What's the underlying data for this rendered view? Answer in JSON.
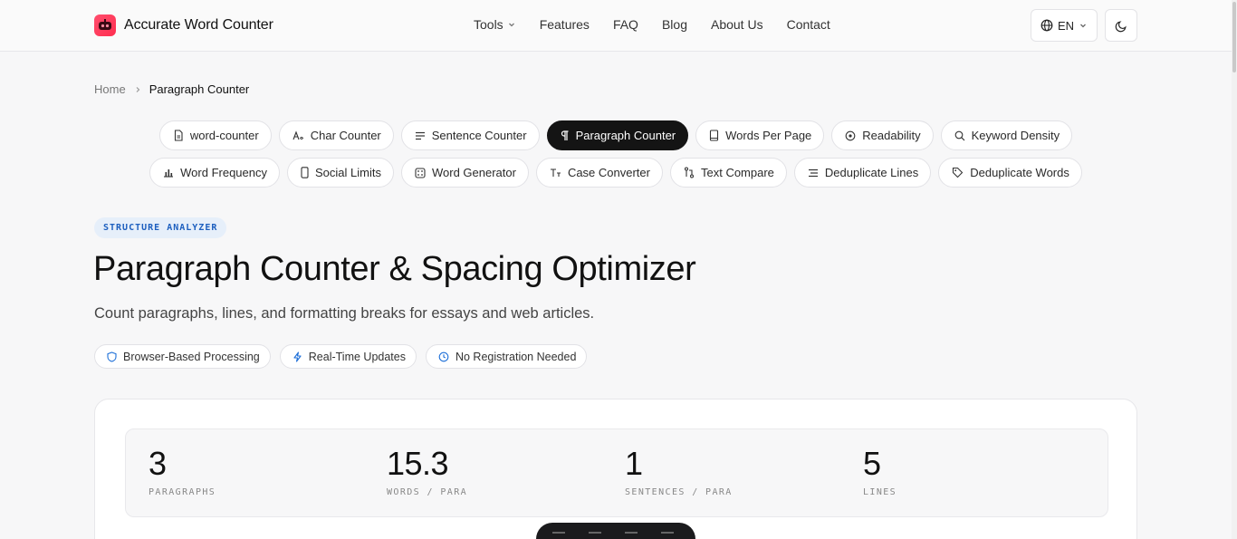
{
  "header": {
    "brand": "Accurate Word Counter",
    "nav": [
      "Tools",
      "Features",
      "FAQ",
      "Blog",
      "About Us",
      "Contact"
    ],
    "lang": "EN"
  },
  "breadcrumb": {
    "home": "Home",
    "current": "Paragraph Counter"
  },
  "tools_row1": [
    "word-counter",
    "Char Counter",
    "Sentence Counter",
    "Paragraph Counter",
    "Words Per Page",
    "Readability",
    "Keyword Density"
  ],
  "tools_row2": [
    "Word Frequency",
    "Social Limits",
    "Word Generator",
    "Case Converter",
    "Text Compare",
    "Deduplicate Lines",
    "Deduplicate Words"
  ],
  "hero": {
    "badge": "STRUCTURE ANALYZER",
    "title": "Paragraph Counter & Spacing Optimizer",
    "subtitle": "Count paragraphs, lines, and formatting breaks for essays and web articles.",
    "features": [
      "Browser-Based Processing",
      "Real-Time Updates",
      "No Registration Needed"
    ]
  },
  "stats": [
    {
      "value": "3",
      "label": "PARAGRAPHS"
    },
    {
      "value": "15.3",
      "label": "WORDS / PARA"
    },
    {
      "value": "1",
      "label": "SENTENCES / PARA"
    },
    {
      "value": "5",
      "label": "LINES"
    }
  ],
  "colors": {
    "accent": "#141414",
    "badge_bg": "#e6effa",
    "badge_text": "#1d5fbf",
    "logo": "#ff3b5c"
  }
}
